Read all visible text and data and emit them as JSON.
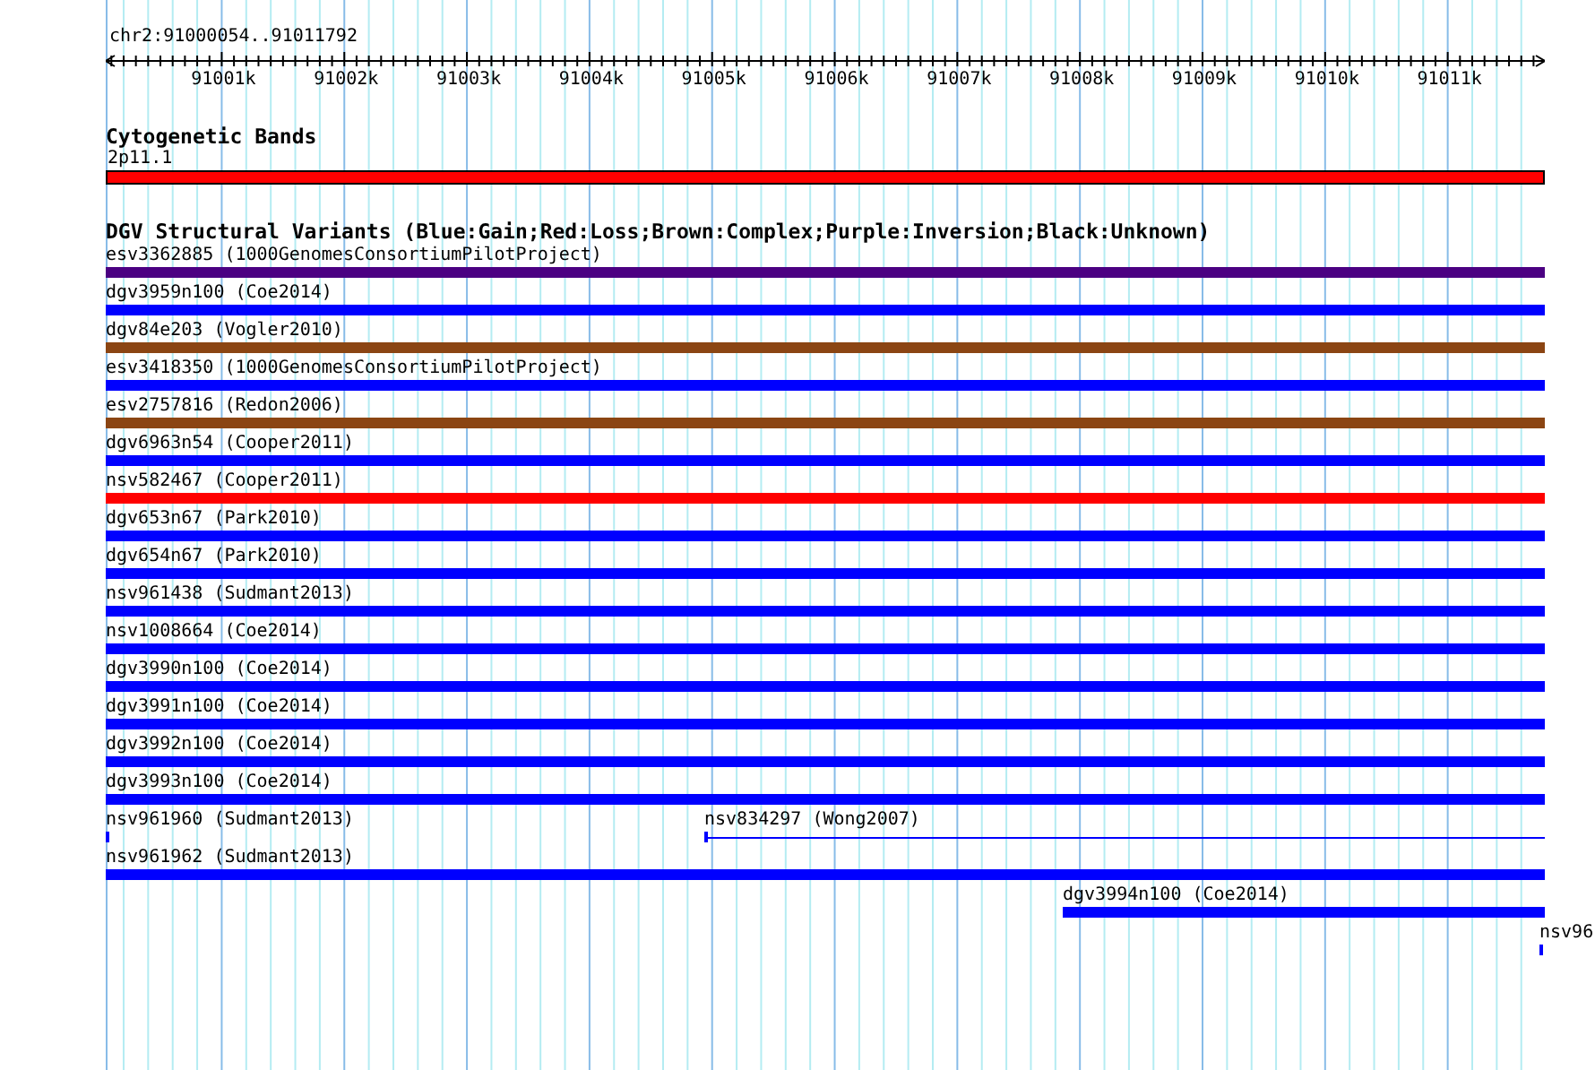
{
  "location": "chr2:91000054..91011792",
  "ruler": {
    "labels": [
      "91001k",
      "91002k",
      "91003k",
      "91004k",
      "91005k",
      "91006k",
      "91007k",
      "91008k",
      "91009k",
      "91010k",
      "91011k"
    ]
  },
  "cytoband_track": {
    "title": "Cytogenetic Bands",
    "band": {
      "label": "2p11.1",
      "color": "#ff0000"
    }
  },
  "dgv_track": {
    "title": "DGV Structural Variants (Blue:Gain;Red:Loss;Brown:Complex;Purple:Inversion;Black:Unknown)",
    "lanes": [
      {
        "features": [
          {
            "label": "esv3362885 (1000GenomesConsortiumPilotProject)",
            "color": "#4b0082",
            "kind": "bar"
          }
        ]
      },
      {
        "features": [
          {
            "label": "dgv3959n100 (Coe2014)",
            "color": "#0000ff",
            "kind": "bar"
          }
        ]
      },
      {
        "features": [
          {
            "label": "dgv84e203 (Vogler2010)",
            "color": "#8b4513",
            "kind": "bar"
          }
        ]
      },
      {
        "features": [
          {
            "label": "esv3418350 (1000GenomesConsortiumPilotProject)",
            "color": "#0000ff",
            "kind": "bar"
          }
        ]
      },
      {
        "features": [
          {
            "label": "esv2757816 (Redon2006)",
            "color": "#8b4513",
            "kind": "bar"
          }
        ]
      },
      {
        "features": [
          {
            "label": "dgv6963n54 (Cooper2011)",
            "color": "#0000ff",
            "kind": "bar"
          }
        ]
      },
      {
        "features": [
          {
            "label": "nsv582467 (Cooper2011)",
            "color": "#ff0000",
            "kind": "bar"
          }
        ]
      },
      {
        "features": [
          {
            "label": "dgv653n67 (Park2010)",
            "color": "#0000ff",
            "kind": "bar"
          }
        ]
      },
      {
        "features": [
          {
            "label": "dgv654n67 (Park2010)",
            "color": "#0000ff",
            "kind": "bar"
          }
        ]
      },
      {
        "features": [
          {
            "label": "nsv961438 (Sudmant2013)",
            "color": "#0000ff",
            "kind": "bar"
          }
        ]
      },
      {
        "features": [
          {
            "label": "nsv1008664 (Coe2014)",
            "color": "#0000ff",
            "kind": "bar"
          }
        ]
      },
      {
        "features": [
          {
            "label": "dgv3990n100 (Coe2014)",
            "color": "#0000ff",
            "kind": "bar"
          }
        ]
      },
      {
        "features": [
          {
            "label": "dgv3991n100 (Coe2014)",
            "color": "#0000ff",
            "kind": "bar"
          }
        ]
      },
      {
        "features": [
          {
            "label": "dgv3992n100 (Coe2014)",
            "color": "#0000ff",
            "kind": "bar"
          }
        ]
      },
      {
        "features": [
          {
            "label": "dgv3993n100 (Coe2014)",
            "color": "#0000ff",
            "kind": "bar"
          }
        ]
      },
      {
        "features": [
          {
            "label": "nsv961960 (Sudmant2013)",
            "color": "#0000ff",
            "kind": "tick"
          },
          {
            "label": "nsv834297 (Wong2007)",
            "color": "#0000ff",
            "kind": "line"
          }
        ]
      },
      {
        "features": [
          {
            "label": "nsv961962 (Sudmant2013)",
            "color": "#0000ff",
            "kind": "bar"
          }
        ]
      },
      {
        "features": [
          {
            "label": "dgv3994n100 (Coe2014)",
            "color": "#0000ff",
            "kind": "bar"
          }
        ]
      },
      {
        "features": [
          {
            "label": "nsv96",
            "color": "#0000ff",
            "kind": "tick"
          }
        ]
      }
    ]
  }
}
